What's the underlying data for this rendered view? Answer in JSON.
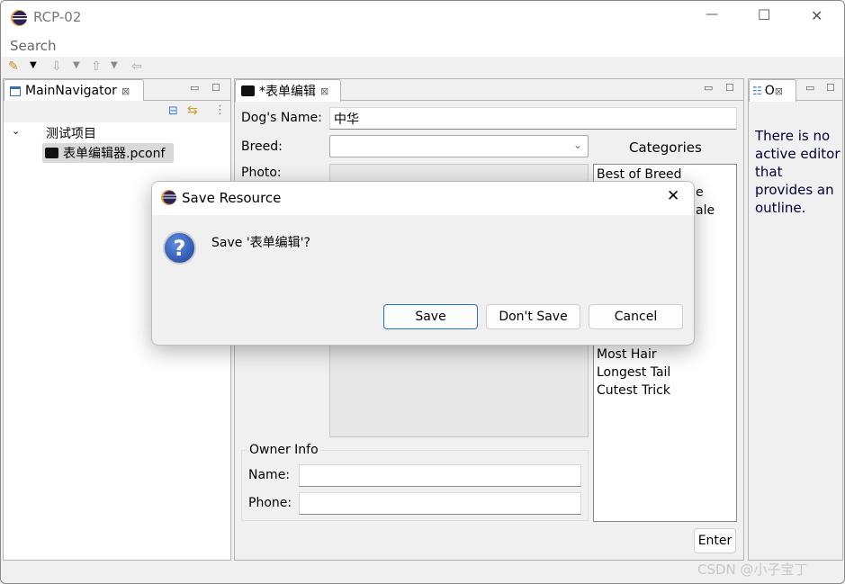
{
  "window": {
    "title": "RCP-02",
    "controls": {
      "minimize": "—",
      "maximize": "☐",
      "close": "✕"
    }
  },
  "menu": {
    "items": [
      "Search"
    ]
  },
  "navigator": {
    "tab_label": "MainNavigator",
    "tree": [
      {
        "label": "测试项目",
        "expanded": true
      },
      {
        "label": "表单编辑器.pconf",
        "selected": true
      }
    ]
  },
  "editor": {
    "tab_label": "*表单编辑",
    "dogs_name_label": "Dog's Name:",
    "dogs_name_value": "中华",
    "breed_label": "Breed:",
    "breed_value": "",
    "photo_label": "Photo:",
    "categories_label": "Categories",
    "categories": [
      "Best of Breed",
      "Most Hair",
      "Longest Tail",
      "Cutest Trick"
    ],
    "categories_partial": [
      "e",
      "ale"
    ],
    "owner_group": "Owner Info",
    "owner_name_label": "Name:",
    "owner_name_value": "",
    "owner_phone_label": "Phone:",
    "owner_phone_value": "",
    "enter_label": "Enter"
  },
  "outline": {
    "tab_label": "O",
    "message": "There is no active editor that provides an outline."
  },
  "dialog": {
    "title": "Save Resource",
    "message": "Save '表单编辑'?",
    "buttons": {
      "save": "Save",
      "dont_save": "Don't Save",
      "cancel": "Cancel"
    },
    "close": "✕"
  },
  "watermark": "CSDN @小子宝丁"
}
